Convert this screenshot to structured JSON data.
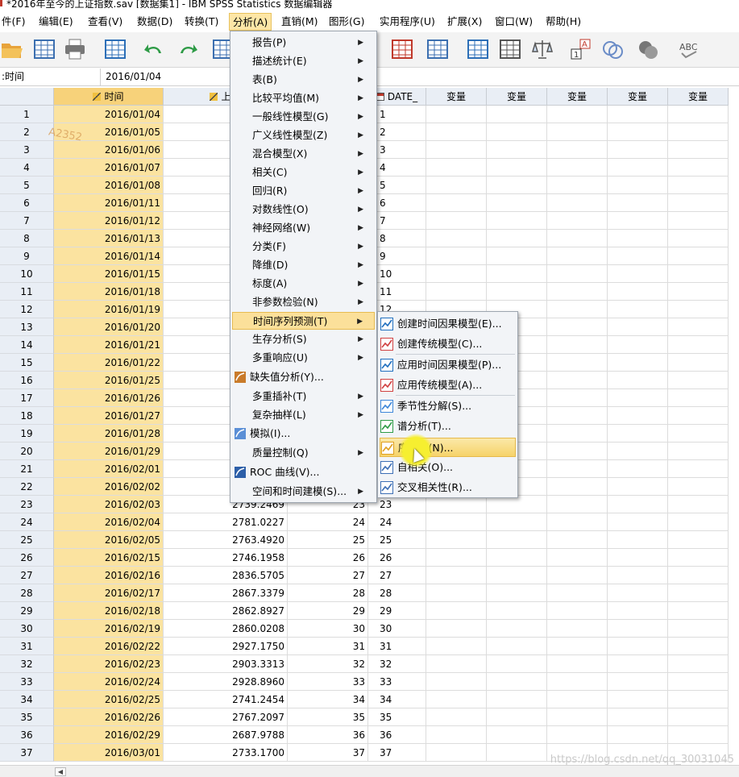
{
  "window": {
    "title": "*2016年至今的上证指数.sav [数据集1] - IBM SPSS Statistics 数据编辑器"
  },
  "menubar": {
    "items": [
      {
        "label": "件(F)",
        "active": false
      },
      {
        "label": "编辑(E)",
        "active": false
      },
      {
        "label": "查看(V)",
        "active": false
      },
      {
        "label": "数据(D)",
        "active": false
      },
      {
        "label": "转换(T)",
        "active": false
      },
      {
        "label": "分析(A)",
        "active": true
      },
      {
        "label": "直销(M)",
        "active": false
      },
      {
        "label": "图形(G)",
        "active": false
      },
      {
        "label": "实用程序(U)",
        "active": false
      },
      {
        "label": "扩展(X)",
        "active": false
      },
      {
        "label": "窗口(W)",
        "active": false
      },
      {
        "label": "帮助(H)",
        "active": false
      }
    ]
  },
  "toolbar": {
    "icons": [
      "open-folder-icon",
      "save-icon",
      "print-icon",
      "data-view-icon",
      "undo-icon",
      "redo-icon",
      "goto-case-icon",
      "select-cases-icon",
      "variables-icon",
      "find-icon",
      "split-file-icon",
      "weight-cases-icon",
      "value-labels-icon",
      "use-sets-icon",
      "show-sets-icon",
      "spell-check-icon"
    ],
    "spell_label": "ABC"
  },
  "cellbar": {
    "name": ":时间",
    "value": "2016/01/04"
  },
  "grid": {
    "columns": [
      {
        "label": "时间",
        "icon": "ruler-pencil-icon",
        "selected": true
      },
      {
        "label": "上证",
        "icon": "ruler-pencil-icon",
        "selected": false
      },
      {
        "label": "",
        "icon": "",
        "selected": false
      },
      {
        "label": "DATE_",
        "icon": "calendar-icon",
        "selected": false
      },
      {
        "label": "变量",
        "icon": "",
        "selected": false
      },
      {
        "label": "变量",
        "icon": "",
        "selected": false
      },
      {
        "label": "变量",
        "icon": "",
        "selected": false
      },
      {
        "label": "变量",
        "icon": "",
        "selected": false
      },
      {
        "label": "变量",
        "icon": "",
        "selected": false
      }
    ],
    "rows": [
      [
        "1",
        "2016/01/04",
        "",
        "",
        "1"
      ],
      [
        "2",
        "2016/01/05",
        "",
        "",
        "2"
      ],
      [
        "3",
        "2016/01/06",
        "",
        "",
        "3"
      ],
      [
        "4",
        "2016/01/07",
        "",
        "",
        "4"
      ],
      [
        "5",
        "2016/01/08",
        "",
        "",
        "5"
      ],
      [
        "6",
        "2016/01/11",
        "",
        "",
        "6"
      ],
      [
        "7",
        "2016/01/12",
        "",
        "",
        "7"
      ],
      [
        "8",
        "2016/01/13",
        "",
        "",
        "8"
      ],
      [
        "9",
        "2016/01/14",
        "",
        "",
        "9"
      ],
      [
        "10",
        "2016/01/15",
        "",
        "",
        "10"
      ],
      [
        "11",
        "2016/01/18",
        "",
        "",
        "11"
      ],
      [
        "12",
        "2016/01/19",
        "",
        "",
        "12"
      ],
      [
        "13",
        "2016/01/20",
        "",
        "",
        ""
      ],
      [
        "14",
        "2016/01/21",
        "",
        "",
        ""
      ],
      [
        "15",
        "2016/01/22",
        "",
        "",
        ""
      ],
      [
        "16",
        "2016/01/25",
        "",
        "",
        ""
      ],
      [
        "17",
        "2016/01/26",
        "",
        "",
        ""
      ],
      [
        "18",
        "2016/01/27",
        "",
        "",
        ""
      ],
      [
        "19",
        "2016/01/28",
        "",
        "",
        ""
      ],
      [
        "20",
        "2016/01/29",
        "",
        "",
        ""
      ],
      [
        "21",
        "2016/02/01",
        "",
        "",
        ""
      ],
      [
        "22",
        "2016/02/02",
        "",
        "",
        ""
      ],
      [
        "23",
        "2016/02/03",
        "2739.2469",
        "23",
        "23"
      ],
      [
        "24",
        "2016/02/04",
        "2781.0227",
        "24",
        "24"
      ],
      [
        "25",
        "2016/02/05",
        "2763.4920",
        "25",
        "25"
      ],
      [
        "26",
        "2016/02/15",
        "2746.1958",
        "26",
        "26"
      ],
      [
        "27",
        "2016/02/16",
        "2836.5705",
        "27",
        "27"
      ],
      [
        "28",
        "2016/02/17",
        "2867.3379",
        "28",
        "28"
      ],
      [
        "29",
        "2016/02/18",
        "2862.8927",
        "29",
        "29"
      ],
      [
        "30",
        "2016/02/19",
        "2860.0208",
        "30",
        "30"
      ],
      [
        "31",
        "2016/02/22",
        "2927.1750",
        "31",
        "31"
      ],
      [
        "32",
        "2016/02/23",
        "2903.3313",
        "32",
        "32"
      ],
      [
        "33",
        "2016/02/24",
        "2928.8960",
        "33",
        "33"
      ],
      [
        "34",
        "2016/02/25",
        "2741.2454",
        "34",
        "34"
      ],
      [
        "35",
        "2016/02/26",
        "2767.2097",
        "35",
        "35"
      ],
      [
        "36",
        "2016/02/29",
        "2687.9788",
        "36",
        "36"
      ],
      [
        "37",
        "2016/03/01",
        "2733.1700",
        "37",
        "37"
      ]
    ]
  },
  "analyze_menu": {
    "items": [
      {
        "label": "报告(P)",
        "submenu": true,
        "icon": "",
        "highlighted": false
      },
      {
        "label": "描述统计(E)",
        "submenu": true,
        "icon": "",
        "highlighted": false
      },
      {
        "label": "表(B)",
        "submenu": true,
        "icon": "",
        "highlighted": false
      },
      {
        "label": "比较平均值(M)",
        "submenu": true,
        "icon": "",
        "highlighted": false
      },
      {
        "label": "一般线性模型(G)",
        "submenu": true,
        "icon": "",
        "highlighted": false
      },
      {
        "label": "广义线性模型(Z)",
        "submenu": true,
        "icon": "",
        "highlighted": false
      },
      {
        "label": "混合模型(X)",
        "submenu": true,
        "icon": "",
        "highlighted": false
      },
      {
        "label": "相关(C)",
        "submenu": true,
        "icon": "",
        "highlighted": false
      },
      {
        "label": "回归(R)",
        "submenu": true,
        "icon": "",
        "highlighted": false
      },
      {
        "label": "对数线性(O)",
        "submenu": true,
        "icon": "",
        "highlighted": false
      },
      {
        "label": "神经网络(W)",
        "submenu": true,
        "icon": "",
        "highlighted": false
      },
      {
        "label": "分类(F)",
        "submenu": true,
        "icon": "",
        "highlighted": false
      },
      {
        "label": "降维(D)",
        "submenu": true,
        "icon": "",
        "highlighted": false
      },
      {
        "label": "标度(A)",
        "submenu": true,
        "icon": "",
        "highlighted": false
      },
      {
        "label": "非参数检验(N)",
        "submenu": true,
        "icon": "",
        "highlighted": false
      },
      {
        "label": "时间序列预测(T)",
        "submenu": true,
        "icon": "",
        "highlighted": true
      },
      {
        "label": "生存分析(S)",
        "submenu": true,
        "icon": "",
        "highlighted": false
      },
      {
        "label": "多重响应(U)",
        "submenu": true,
        "icon": "",
        "highlighted": false
      },
      {
        "label": "缺失值分析(Y)...",
        "submenu": false,
        "icon": "missing-values-icon",
        "highlighted": false
      },
      {
        "label": "多重插补(T)",
        "submenu": true,
        "icon": "",
        "highlighted": false
      },
      {
        "label": "复杂抽样(L)",
        "submenu": true,
        "icon": "",
        "highlighted": false
      },
      {
        "label": "模拟(I)...",
        "submenu": false,
        "icon": "simulation-icon",
        "highlighted": false
      },
      {
        "label": "质量控制(Q)",
        "submenu": true,
        "icon": "",
        "highlighted": false
      },
      {
        "label": "ROC 曲线(V)...",
        "submenu": false,
        "icon": "roc-curve-icon",
        "highlighted": false
      },
      {
        "label": "空间和时间建模(S)...",
        "submenu": true,
        "icon": "",
        "highlighted": false
      }
    ]
  },
  "ts_menu": {
    "items": [
      {
        "label": "创建时间因果模型(E)...",
        "icon": "temporal-causal-icon",
        "highlighted": false
      },
      {
        "label": "创建传统模型(C)...",
        "icon": "create-model-icon",
        "highlighted": false
      },
      {
        "label": "应用时间因果模型(P)...",
        "icon": "apply-temporal-icon",
        "highlighted": false
      },
      {
        "label": "应用传统模型(A)...",
        "icon": "apply-model-icon",
        "highlighted": false
      },
      {
        "label": "季节性分解(S)...",
        "icon": "seasonal-icon",
        "highlighted": false
      },
      {
        "label": "谱分析(T)...",
        "icon": "spectral-icon",
        "highlighted": false
      },
      {
        "label": "序列图(N)...",
        "icon": "sequence-chart-icon",
        "highlighted": true
      },
      {
        "label": "自相关(O)...",
        "icon": "autocorrelation-icon",
        "highlighted": false
      },
      {
        "label": "交叉相关性(R)...",
        "icon": "cross-correlation-icon",
        "highlighted": false
      }
    ]
  },
  "overlay": {
    "stamp": "A2352",
    "watermark": "https://blog.csdn.net/qq_30031045"
  },
  "colors": {
    "highlight": "#fbe09a",
    "date_column": "#fbe3a0",
    "header": "#e9eef5",
    "cursor_glow": "#f6ef30"
  }
}
